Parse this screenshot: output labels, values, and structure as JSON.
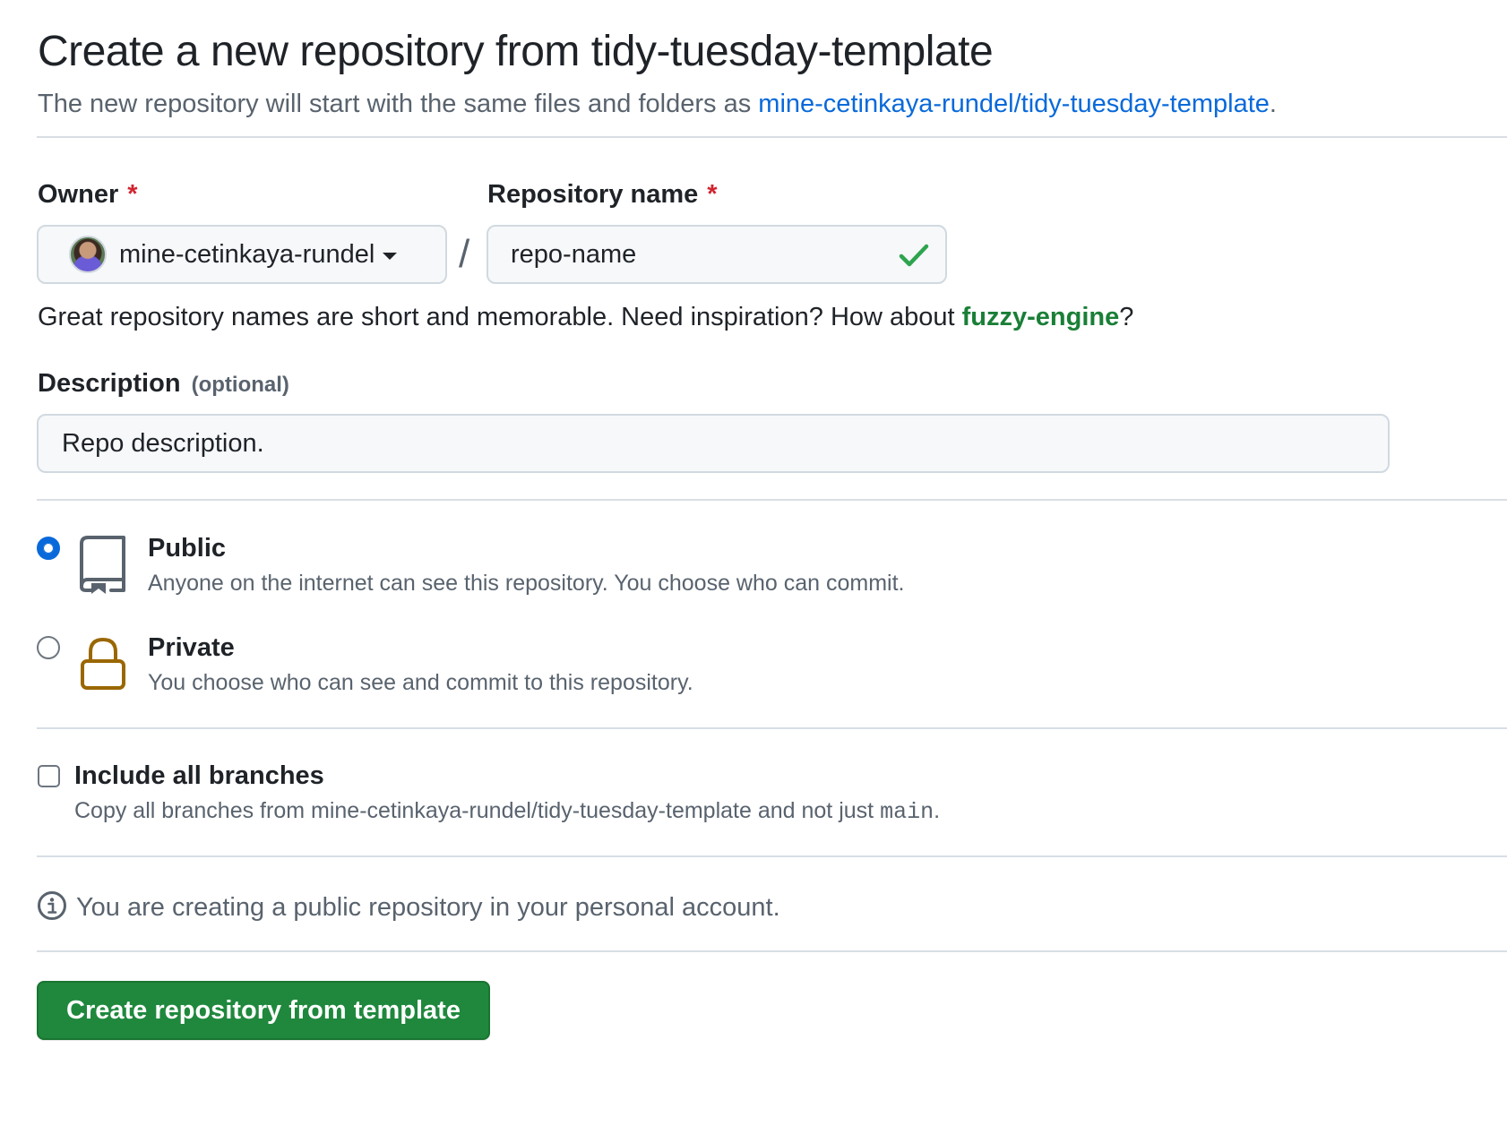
{
  "header": {
    "title": "Create a new repository from tidy-tuesday-template",
    "subtitle_prefix": "The new repository will start with the same files and folders as ",
    "template_link": "mine-cetinkaya-rundel/tidy-tuesday-template",
    "subtitle_suffix": "."
  },
  "owner": {
    "label": "Owner",
    "required_marker": "*",
    "value": "mine-cetinkaya-rundel"
  },
  "separator": "/",
  "repo_name": {
    "label": "Repository name",
    "required_marker": "*",
    "value": "repo-name",
    "valid": true
  },
  "name_hint": {
    "prefix": "Great repository names are short and memorable. Need inspiration? How about ",
    "suggestion": "fuzzy-engine",
    "suffix": "?"
  },
  "description": {
    "label": "Description",
    "optional_tag": "(optional)",
    "value": "Repo description."
  },
  "visibility": {
    "selected": "public",
    "public": {
      "title": "Public",
      "description": "Anyone on the internet can see this repository. You choose who can commit."
    },
    "private": {
      "title": "Private",
      "description": "You choose who can see and commit to this repository."
    }
  },
  "branches": {
    "checked": false,
    "title": "Include all branches",
    "description_prefix": "Copy all branches from mine-cetinkaya-rundel/tidy-tuesday-template and not just ",
    "branch_name": "main",
    "description_suffix": "."
  },
  "info": {
    "text": "You are creating a public repository in your personal account."
  },
  "submit": {
    "label": "Create repository from template"
  },
  "colors": {
    "accent_blue": "#0969da",
    "success_green": "#1f883d",
    "required_red": "#d1242f",
    "lock_brown": "#9a6700"
  }
}
